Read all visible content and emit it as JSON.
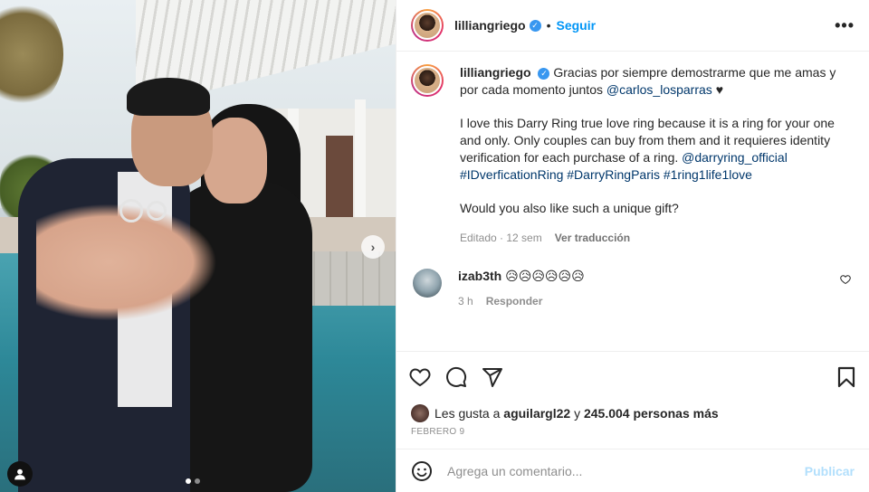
{
  "post": {
    "username": "lilliangriego",
    "follow_label": "Seguir",
    "separator": "•",
    "more_label": "•••",
    "caption": {
      "username": "lilliangriego",
      "line1": "Gracias por siempre demostrarme que me amas y por cada momento juntos",
      "mention": "@carlos_losparras",
      "heart": "♥",
      "para2": "I love this Darry Ring true love ring because it is a ring for your one and only. Only couples can buy from them and it requieres identity verification for each purchase of a ring.",
      "tags": "@darryring_official #IDverficationRing #DarryRingParis #1ring1life1love",
      "para3": "Would you also like such a unique gift?"
    },
    "meta": {
      "edited": "Editado · 12 sem",
      "translate": "Ver traducción"
    }
  },
  "comment": {
    "username": "izab3th",
    "emojis": "😥😥😥😥😥😥",
    "time": "3 h",
    "reply": "Responder"
  },
  "likes": {
    "prefix": "Les gusta a",
    "user": "aguilargl22",
    "join": "y",
    "count": "245.004 personas más"
  },
  "date": "FEBRERO 9",
  "add_comment": {
    "placeholder": "Agrega un comentario...",
    "publish": "Publicar"
  },
  "carousel": {
    "next_label": "›",
    "slides": 2,
    "active": 1
  },
  "colors": {
    "link": "#0095f6",
    "mention": "#00376b",
    "muted": "#8e8e8e",
    "publish_disabled": "#b2dffc",
    "verified": "#3897f0"
  },
  "icons": {
    "verified": "verified-badge-icon",
    "like": "heart-icon",
    "comment": "comment-bubble-icon",
    "share": "paper-plane-icon",
    "save": "bookmark-icon",
    "emoji": "smiley-icon",
    "tag": "user-tag-icon",
    "next": "chevron-right-icon"
  }
}
